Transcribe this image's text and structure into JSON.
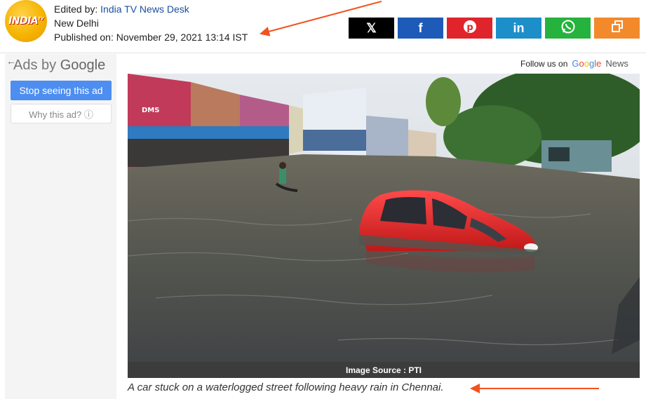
{
  "header": {
    "logo_text": "INDIA",
    "logo_sup": "TV",
    "editor_prefix": "Edited by: ",
    "editor_name": "India TV News Desk",
    "location": "New Delhi",
    "published": "Published on: November 29, 2021 13:14 IST"
  },
  "share": [
    {
      "name": "x",
      "glyph": "𝕏",
      "color": "#000000"
    },
    {
      "name": "facebook",
      "glyph": "f",
      "color": "#1e5bb8"
    },
    {
      "name": "pinterest",
      "glyph": "P",
      "color": "#e0242c"
    },
    {
      "name": "linkedin",
      "glyph": "in",
      "color": "#1c8fc8"
    },
    {
      "name": "whatsapp",
      "glyph": "✆",
      "color": "#25b33d"
    },
    {
      "name": "copy",
      "glyph": "⧉",
      "color": "#f28a2b"
    }
  ],
  "ad": {
    "back_glyph": "←",
    "ads_by": "Ads by",
    "google": "Google",
    "stop_label": "Stop seeing this ad",
    "why_label": "Why this ad? ⓘ"
  },
  "follow": {
    "label": "Follow us on",
    "google": [
      "G",
      "o",
      "o",
      "g",
      "l",
      "e"
    ],
    "news": "News"
  },
  "photo": {
    "source": "Image Source : PTI",
    "caption": "A car stuck on a waterlogged street following heavy rain in Chennai."
  },
  "colors": {
    "annotation_arrow": "#f0531f",
    "brand_gold": "#f5b400"
  }
}
